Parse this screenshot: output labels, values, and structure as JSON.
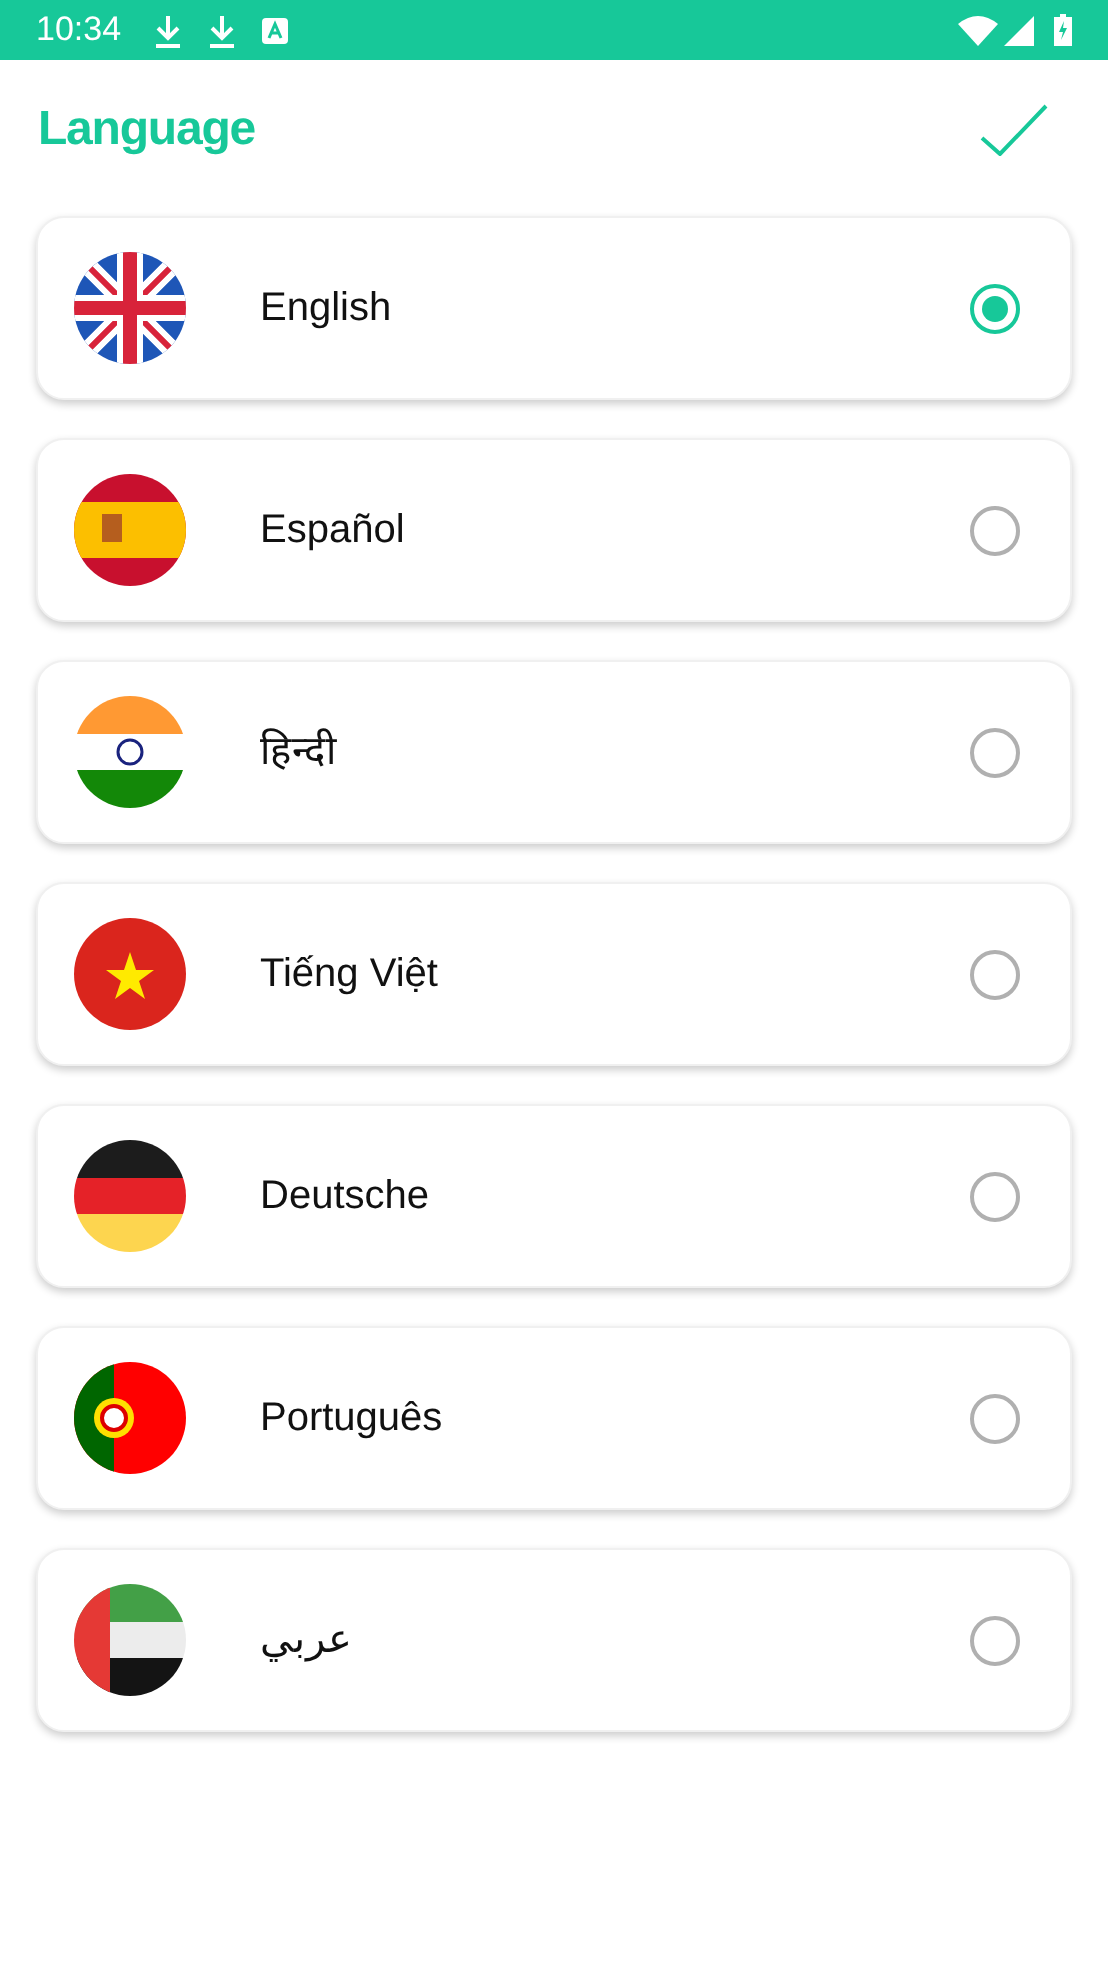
{
  "status_bar": {
    "time": "10:34"
  },
  "header": {
    "title": "Language"
  },
  "languages": [
    {
      "name": "English",
      "kind": "uk",
      "selected": true
    },
    {
      "name": "Español",
      "kind": "spain",
      "selected": false
    },
    {
      "name": "हिन्दी",
      "kind": "india",
      "selected": false
    },
    {
      "name": "Tiếng Việt",
      "kind": "vietnam",
      "selected": false
    },
    {
      "name": "Deutsche",
      "kind": "germany",
      "selected": false
    },
    {
      "name": "Português",
      "kind": "portugal",
      "selected": false
    },
    {
      "name": "عربي",
      "kind": "uae",
      "selected": false
    }
  ]
}
